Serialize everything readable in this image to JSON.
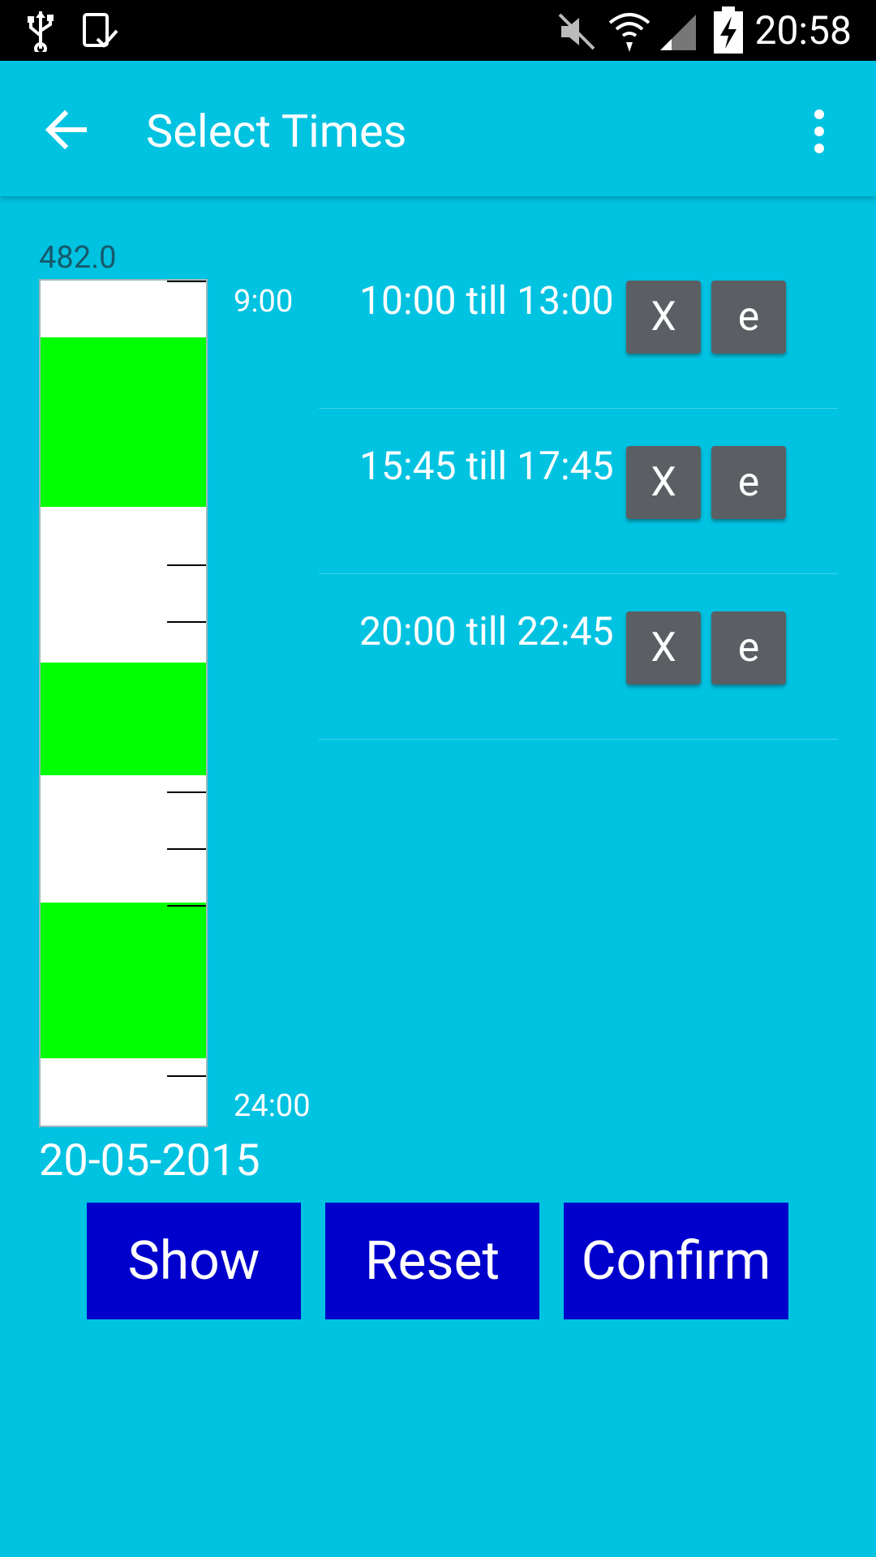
{
  "status_bar": {
    "time": "20:58",
    "icons": [
      "usb-icon",
      "download-done-icon",
      "vibrate-mute-icon",
      "wifi-icon",
      "signal-icon",
      "battery-charging-icon"
    ]
  },
  "app_bar": {
    "title": "Select Times",
    "back_icon": "arrow-left-icon",
    "menu_icon": "more-vert-icon"
  },
  "timeline": {
    "top_value": "482.0",
    "start_label": "9:00",
    "end_label": "24:00",
    "date": "20-05-2015",
    "range_start_hour": 9,
    "range_end_hour": 24,
    "blocks": [
      {
        "start": "10:00",
        "end": "13:00"
      },
      {
        "start": "15:45",
        "end": "17:45"
      },
      {
        "start": "20:00",
        "end": "22:45"
      }
    ],
    "colors": {
      "free": "#ffffff",
      "booked": "#00ff00"
    }
  },
  "slots": [
    {
      "label": "10:00 till 13:00",
      "delete_label": "X",
      "edit_label": "e"
    },
    {
      "label": "15:45 till 17:45",
      "delete_label": "X",
      "edit_label": "e"
    },
    {
      "label": "20:00 till 22:45",
      "delete_label": "X",
      "edit_label": "e"
    }
  ],
  "actions": {
    "show": "Show",
    "reset": "Reset",
    "confirm": "Confirm"
  },
  "colors": {
    "background": "#00c2e1",
    "button_blue": "#0000cc",
    "row_button": "#5b5f63"
  }
}
